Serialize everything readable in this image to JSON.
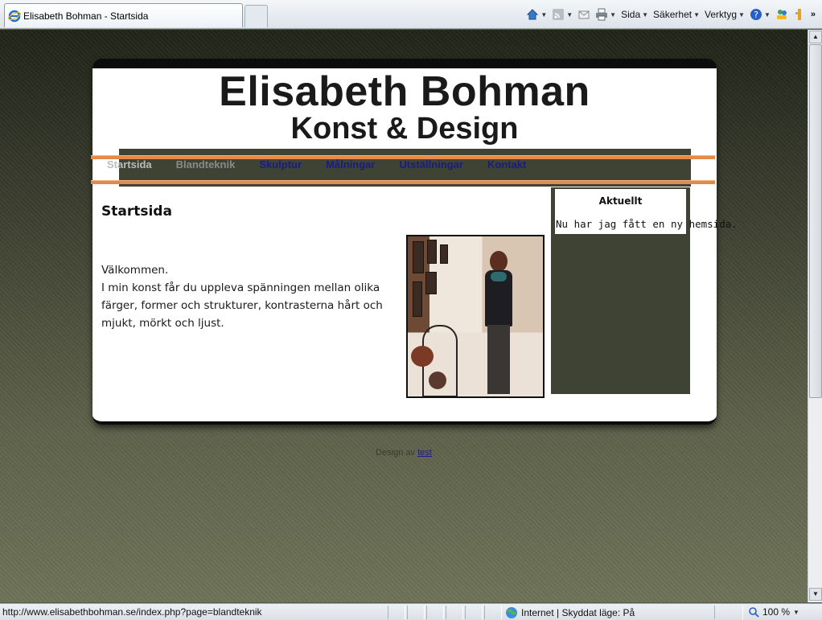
{
  "browser": {
    "tab_title": "Elisabeth Bohman - Startsida",
    "commands": {
      "page": "Sida",
      "safety": "Säkerhet",
      "tools": "Verktyg"
    }
  },
  "site": {
    "title": "Elisabeth Bohman",
    "subtitle": "Konst & Design",
    "nav": [
      "Startsida",
      "Blandteknik",
      "Skulptur",
      "Målningar",
      "Utställningar",
      "Kontakt"
    ],
    "content": {
      "heading": "Startsida",
      "welcome": "Välkommen.",
      "body": "I min konst får du uppleva  spänningen mellan olika färger, former och strukturer, kontrasterna hårt och mjukt, mörkt och ljust."
    },
    "sidebar": {
      "heading": "Aktuellt",
      "news": "Nu har jag fått en ny hemsida."
    },
    "footer": {
      "prefix": "Design av",
      "link": "test"
    }
  },
  "status": {
    "url": "http://www.elisabethbohman.se/index.php?page=blandteknik",
    "zone": "Internet | Skyddat läge: På",
    "zoom": "100 %"
  },
  "colors": {
    "nav_band": "#3f4334",
    "accent_line": "#e48a4a",
    "link": "#1a1a8a"
  }
}
